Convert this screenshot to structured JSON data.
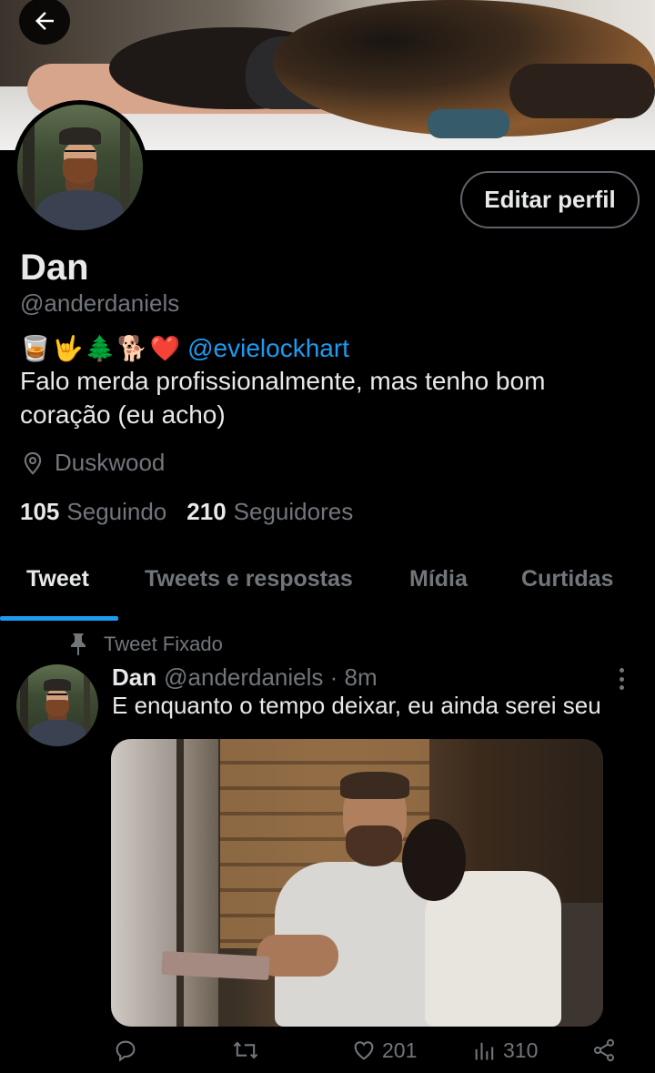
{
  "profile": {
    "name": "Dan",
    "handle": "@anderdaniels",
    "bio_emojis": [
      "🥃",
      "🤟",
      "🌲",
      "🐕",
      "❤️"
    ],
    "bio_mention": "@evielockhart",
    "bio_text": "Falo merda profissionalmente, mas tenho bom coração (eu acho)",
    "location": "Duskwood",
    "following_count": "105",
    "following_label": "Seguindo",
    "followers_count": "210",
    "followers_label": "Seguidores",
    "edit_label": "Editar perfil"
  },
  "tabs": [
    {
      "label": "Tweet",
      "active": true
    },
    {
      "label": "Tweets e respostas",
      "active": false
    },
    {
      "label": "Mídia",
      "active": false
    },
    {
      "label": "Curtidas",
      "active": false
    }
  ],
  "pinned_tweet": {
    "pinned_label": "Tweet Fixado",
    "author_name": "Dan",
    "meta": "@anderdaniels · 8m",
    "text": "E enquanto o tempo deixar, eu ainda serei seu",
    "likes": "201",
    "views": "310"
  },
  "colors": {
    "accent": "#1d9bf0",
    "secondary_text": "#71767b",
    "primary_text": "#e7e9ea",
    "background": "#000000"
  },
  "icons": {
    "back": "arrow-left-icon",
    "location": "location-pin-icon",
    "pin": "pin-icon",
    "more": "more-vertical-icon",
    "reply": "reply-icon",
    "retweet": "retweet-icon",
    "like": "heart-icon",
    "views": "views-chart-icon",
    "share": "share-icon"
  }
}
